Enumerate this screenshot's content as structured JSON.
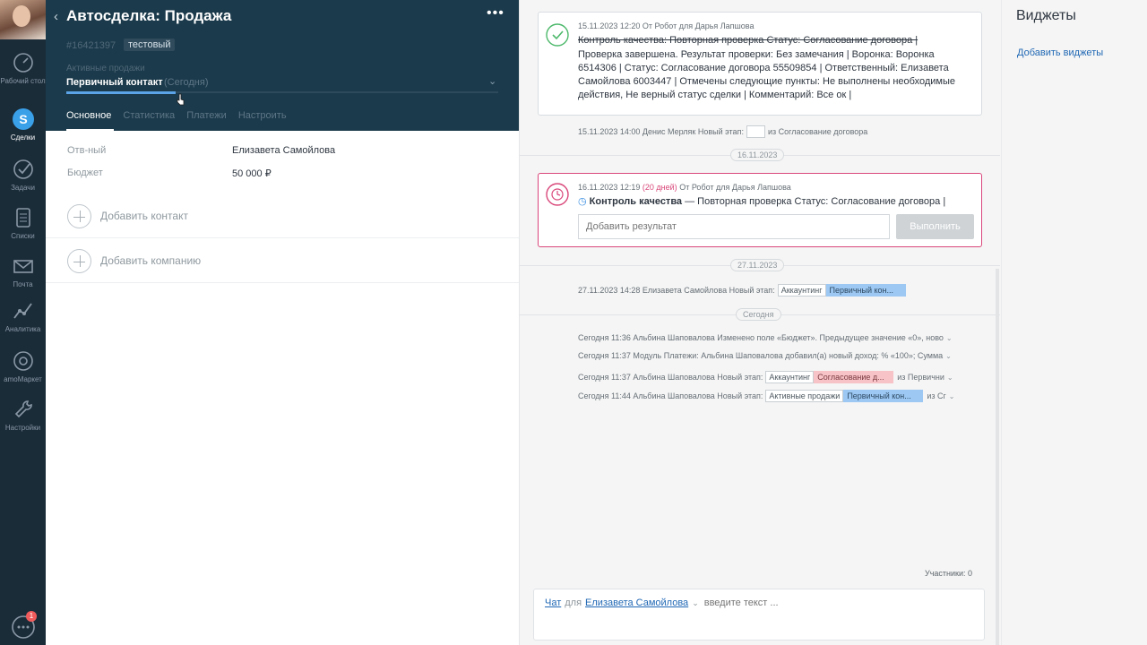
{
  "nav": {
    "items": [
      {
        "label": "Рабочий стол",
        "icon": "dashboard-icon"
      },
      {
        "label": "Сделки",
        "icon": "deals-icon"
      },
      {
        "label": "Задачи",
        "icon": "tasks-icon"
      },
      {
        "label": "Списки",
        "icon": "lists-icon"
      },
      {
        "label": "Почта",
        "icon": "mail-icon"
      },
      {
        "label": "Аналитика",
        "icon": "analytics-icon"
      },
      {
        "label": "amoМаркет",
        "icon": "market-icon"
      },
      {
        "label": "Настройки",
        "icon": "settings-icon"
      }
    ],
    "chat_badge": "1"
  },
  "card": {
    "title": "Автосделка: Продажа",
    "id": "#16421397",
    "tag": "тестовый",
    "pipeline": "Активные продажи",
    "stage": "Первичный контакт",
    "stage_time": "(Сегодня)",
    "tabs": [
      "Основное",
      "Статистика",
      "Платежи",
      "Настроить"
    ],
    "fields": [
      {
        "label": "Отв-ный",
        "value": "Елизавета Самойлова"
      },
      {
        "label": "Бюджет",
        "value": "50 000  ₽"
      }
    ],
    "add_contact": "Добавить контакт",
    "add_company": "Добавить компанию"
  },
  "feed": {
    "note1": {
      "meta": "15.11.2023 12:20  От Робот для Дарья Лапшова",
      "title_struck": "Контроль качества: Повторная проверка Статус: Согласование договора |",
      "body": "Проверка завершена. Результат проверки: Без замечания | Воронка: Воронка 6514306 | Статус: Согласование договора 55509854 | Ответственный: Елизавета Самойлова 6003447 | Отмечены следующие пункты: Не выполнены необходимые действия, Не верный статус сделки | Комментарий: Все ок |"
    },
    "event0": {
      "text": "15.11.2023 14:00 Денис Мерляк Новый этап:",
      "suffix": "из Согласование договора"
    },
    "date1": "16.11.2023",
    "note2": {
      "meta_date": "16.11.2023 12:19",
      "meta_overdue": "(20 дней)",
      "meta_rest": "От Робот для Дарья Лапшова",
      "task_type": "Контроль качества",
      "task_text": "— Повторная проверка Статус: Согласование договора |",
      "input_placeholder": "Добавить результат",
      "button": "Выполнить"
    },
    "date2": "27.11.2023",
    "event1": {
      "text": "27.11.2023 14:28 Елизавета Самойлова Новый этап:",
      "chip_a": "Аккаунтинг",
      "chip_b": "Первичный кон..."
    },
    "date3": "Сегодня",
    "events": [
      {
        "text": "Сегодня 11:36 Альбина Шаповалова Изменено поле «Бюджет». Предыдущее значение «0», ново"
      },
      {
        "text": "Сегодня 11:37 Модуль Платежи: Альбина Шаповалова добавил(а) новый доход: % «100»; Сумма"
      },
      {
        "text": "Сегодня 11:37 Альбина Шаповалова Новый этап:",
        "chip_a": "Аккаунтинг",
        "chip_b": "Согласование д...",
        "suffix": "из Первични"
      },
      {
        "text": "Сегодня 11:44 Альбина Шаповалова Новый этап:",
        "chip_a": "Активные продажи",
        "chip_b": "Первичный кон...",
        "suffix": "из Сг"
      }
    ],
    "participants": "Участники: 0",
    "composer": {
      "chat": "Чат",
      "for": "для",
      "recipient": "Елизавета Самойлова",
      "placeholder": "введите текст ..."
    }
  },
  "widgets": {
    "title": "Виджеты",
    "add": "Добавить виджеты"
  },
  "colors": {
    "nav_bg": "#1b2c39",
    "card_head_bg": "#1b3a4b",
    "accent_blue": "#5ba4e8",
    "done_green": "#4cb86a",
    "overdue_pink": "#d9477a",
    "chip_blue": "#9cc8f3",
    "chip_pink": "#f7c3c6",
    "link": "#1f67b4"
  }
}
